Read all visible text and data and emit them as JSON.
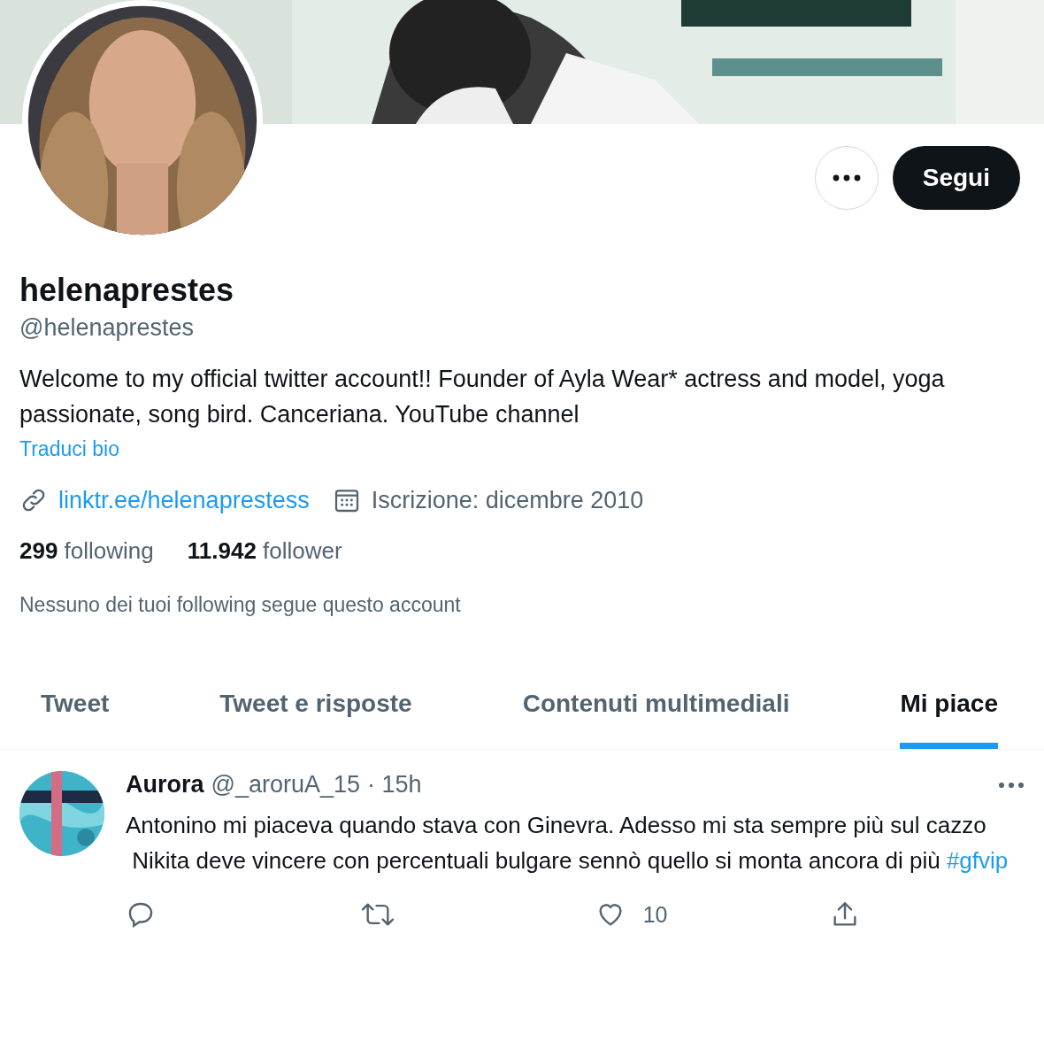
{
  "profile": {
    "name": "helenaprestes",
    "handle": "@helenaprestes",
    "bio": "Welcome to my official twitter account!! Founder of Ayla Wear* actress and model, yoga passionate, song bird. Canceriana. YouTube channel",
    "translate": "Traduci bio",
    "link": "linktr.ee/helenaprestess",
    "joined": "Iscrizione: dicembre 2010",
    "stats": [
      "**299** following",
      "**11.942** follower"
    ],
    "mutuals": "Nessuno dei tuoi following segue questo account",
    "follow_button": "Segui"
  },
  "tabs": [
    {
      "label": "Tweet",
      "selected": false
    },
    {
      "label": "Tweet e risposte",
      "selected": false
    },
    {
      "label": "Contenuti multimediali",
      "selected": false
    },
    {
      "label": "Mi piace",
      "selected": true
    }
  ],
  "tweet": {
    "author": "Aurora",
    "handle": "@_aroruA_15",
    "time": "· 15h",
    "text": "Antonino mi piaceva quando stava con Ginevra. Adesso mi sta sempre più sul cazzo\n Nikita deve vincere con percentuali bulgare sennò quello si monta ancora di più ",
    "hashtag": "#gfvip",
    "actions": [
      {
        "kind": "reply"
      },
      {
        "kind": "retweet"
      },
      {
        "kind": "like",
        "count": "10"
      },
      {
        "kind": "share"
      }
    ]
  }
}
